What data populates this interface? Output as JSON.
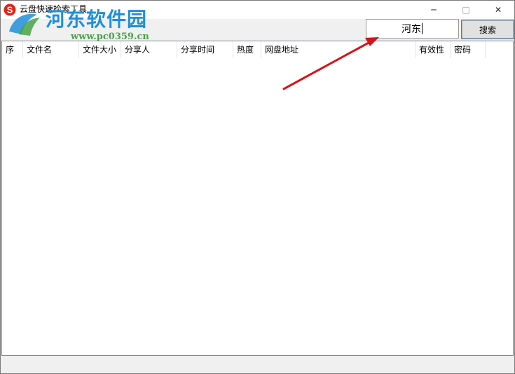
{
  "window": {
    "title": "云盘快速检索工具",
    "minimize_glyph": "─",
    "maximize_glyph": "□",
    "close_glyph": "✕"
  },
  "watermark": {
    "site_name": "河东软件园",
    "url": "www.pc0359.cn"
  },
  "search": {
    "input_value": "河东",
    "button_label": "搜索"
  },
  "table": {
    "columns": [
      "序",
      "文件名",
      "文件大小",
      "分享人",
      "分享时间",
      "热度",
      "网盘地址",
      "有效性",
      "密码"
    ],
    "rows": []
  },
  "icons": {
    "app": "sogou-s-icon",
    "annotation": "red-arrow"
  },
  "colors": {
    "app_icon_red": "#e2231a",
    "watermark_blue": "#1e8fdc",
    "watermark_green": "#49a347",
    "arrow_red": "#d8121a",
    "button_border": "#4a7fc0"
  }
}
